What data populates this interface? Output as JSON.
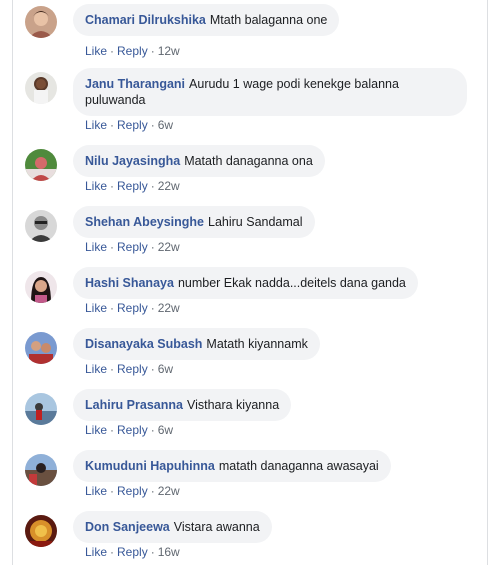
{
  "comments": [
    {
      "author": "Chamari Dilrukshika",
      "text": "Mtath balaganna one",
      "like": "Like",
      "reply": "Reply",
      "time": "12w"
    },
    {
      "author": "Janu Tharangani",
      "text": "Aurudu 1 wage podi kenekge balanna",
      "text2": "puluwanda",
      "like": "Like",
      "reply": "Reply",
      "time": "6w"
    },
    {
      "author": "Nilu Jayasingha",
      "text": "Matath danaganna ona",
      "like": "Like",
      "reply": "Reply",
      "time": "22w"
    },
    {
      "author": "Shehan Abeysinghe",
      "text": "Lahiru Sandamal",
      "like": "Like",
      "reply": "Reply",
      "time": "22w"
    },
    {
      "author": "Hashi Shanaya",
      "text": "number Ekak nadda...deitels dana ganda",
      "like": "Like",
      "reply": "Reply",
      "time": "22w"
    },
    {
      "author": "Disanayaka Subash",
      "text": "Matath kiyannamk",
      "like": "Like",
      "reply": "Reply",
      "time": "6w"
    },
    {
      "author": "Lahiru Prasanna",
      "text": "Visthara kiyanna",
      "like": "Like",
      "reply": "Reply",
      "time": "6w"
    },
    {
      "author": "Kumuduni Hapuhinna",
      "text": "matath danaganna awasayai",
      "like": "Like",
      "reply": "Reply",
      "time": "22w"
    },
    {
      "author": "Don Sanjeewa",
      "text": "Vistara awanna",
      "like": "Like",
      "reply": "Reply",
      "time": "16w"
    }
  ],
  "separator": "·"
}
